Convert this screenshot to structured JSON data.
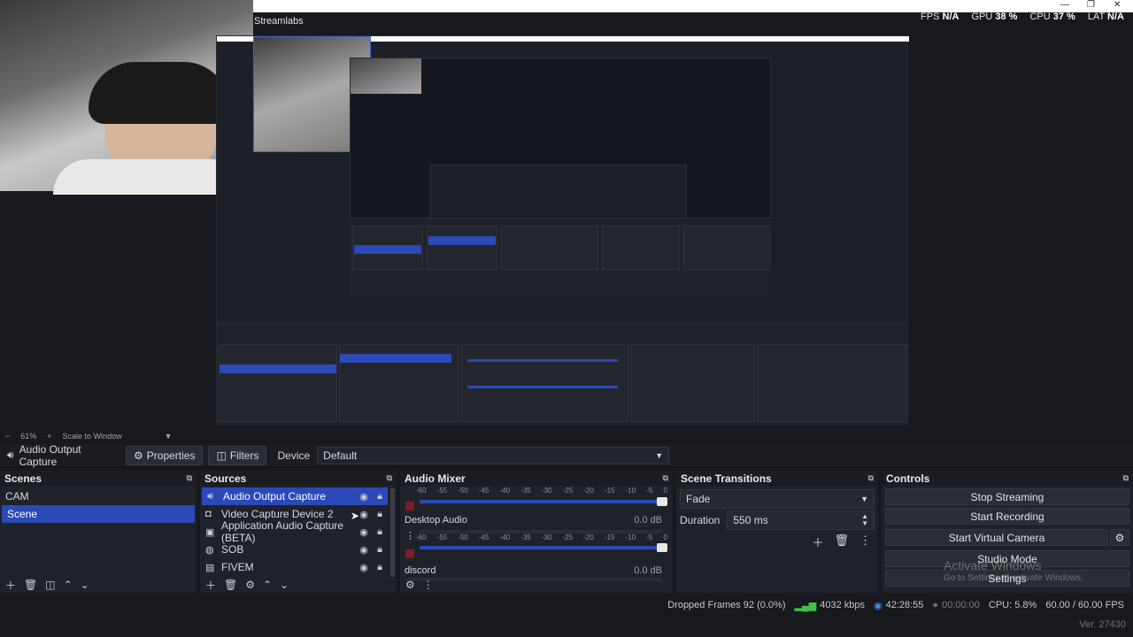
{
  "window": {
    "title": "Streamlabs",
    "controls": [
      "—",
      "❐",
      "✕"
    ]
  },
  "stats": {
    "fps_label": "FPS",
    "fps_value": "N/A",
    "gpu_label": "GPU",
    "gpu_value": "38 %",
    "cpu_label": "CPU",
    "cpu_value": "37 %",
    "lat_label": "LAT",
    "lat_value": "N/A"
  },
  "zoom": {
    "minus": "−",
    "value": "61%",
    "plus": "+",
    "mode": "Scale to Window",
    "dropdown": "▼"
  },
  "source_toolbar": {
    "source_name": "Audio Output Capture",
    "properties_label": "Properties",
    "filters_label": "Filters",
    "device_label": "Device",
    "device_value": "Default"
  },
  "scenes": {
    "title": "Scenes",
    "items": [
      "CAM",
      "Scene"
    ],
    "selected": "Scene"
  },
  "sources": {
    "title": "Sources",
    "items": [
      {
        "name": "Audio Output Capture",
        "icon": "speaker-icon"
      },
      {
        "name": "Video Capture Device 2",
        "icon": "camera-icon"
      },
      {
        "name": "Application Audio Capture (BETA)",
        "icon": "app-audio-icon"
      },
      {
        "name": "SOB",
        "icon": "globe-icon"
      },
      {
        "name": "FIVEM",
        "icon": "game-capture-icon"
      }
    ]
  },
  "mixer": {
    "title": "Audio Mixer",
    "scale": [
      "-60",
      "-55",
      "-50",
      "-45",
      "-40",
      "-35",
      "-30",
      "-25",
      "-20",
      "-15",
      "-10",
      "-5",
      "0"
    ],
    "channels": [
      {
        "name": "",
        "db": ""
      },
      {
        "name": "Desktop Audio",
        "db": "0.0 dB"
      },
      {
        "name": "discord",
        "db": "0.0 dB"
      }
    ]
  },
  "transitions": {
    "title": "Scene Transitions",
    "selected": "Fade",
    "duration_label": "Duration",
    "duration_value": "550 ms"
  },
  "controls": {
    "title": "Controls",
    "stop_streaming": "Stop Streaming",
    "start_recording": "Start Recording",
    "start_virtual_camera": "Start Virtual Camera",
    "studio_mode": "Studio Mode",
    "settings": "Settings"
  },
  "status": {
    "dropped_frames": "Dropped Frames 92 (0.0%)",
    "bitrate": "4032 kbps",
    "stream_time": "42:28:55",
    "rec_time": "00:00:00",
    "cpu": "CPU: 5.8%",
    "fps": "60.00 / 60.00 FPS",
    "version": "Ver. 27430"
  },
  "watermark": {
    "line1": "Activate Windows",
    "line2": "Go to Settings to activate Windows."
  }
}
